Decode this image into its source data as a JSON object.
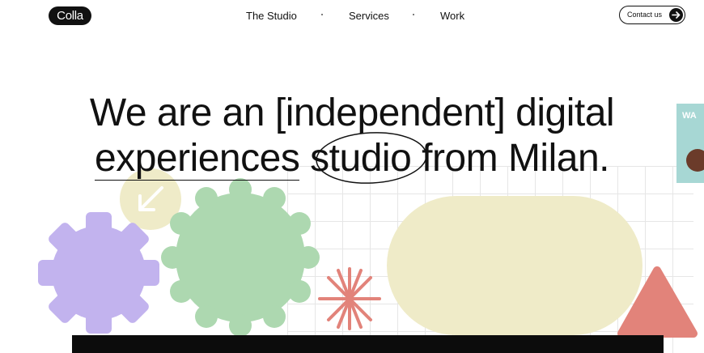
{
  "header": {
    "logo_text": "Colla",
    "nav": [
      {
        "label": "The Studio"
      },
      {
        "label": "Services"
      },
      {
        "label": "Work"
      }
    ],
    "contact_label": "Contact us"
  },
  "hero": {
    "line1_a": "We are an",
    "line1_b": "independent",
    "line1_c": "digital",
    "line2_a": "experiences",
    "line2_b": "studio",
    "line2_c": "from Milan."
  },
  "side_card": {
    "text": "WA"
  },
  "colors": {
    "purple": "#c2b3ee",
    "green": "#add8b0",
    "yellow": "#efebc8",
    "coral": "#e2837a",
    "teal": "#a7d7d4",
    "ink": "#111111"
  },
  "icons": [
    "arrow-right-icon",
    "arrow-down-left-icon"
  ]
}
